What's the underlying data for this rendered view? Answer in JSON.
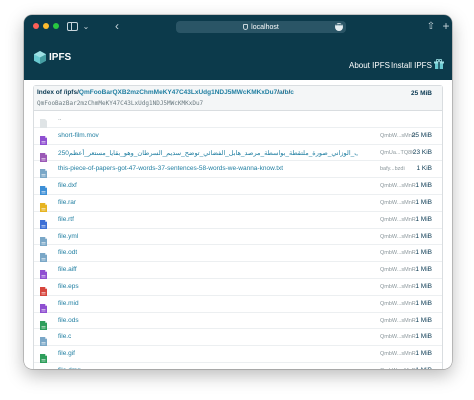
{
  "browser": {
    "address": "localhost",
    "address_more": "•••"
  },
  "header": {
    "logo_text": "IPFS",
    "nav_about": "About IPFS",
    "nav_install": "Install IPFS"
  },
  "index": {
    "prefix": "Index of /ipfs/",
    "cid_link": "QmFooBarQXB2mzChmMeKY47C43LxUdg1NDJ5MWcKMKxDu7",
    "path_a": "a",
    "path_b": "b",
    "path_c": "c",
    "slash": "/",
    "cid": "QmFooBazBar2mzChmMeKY47C43LxUdg1NDJ5MWcKMKxDu7",
    "size": "25 MiB"
  },
  "parent": {
    "name": ".."
  },
  "files": [
    {
      "name": "short-film.mov",
      "hash": "QmbW...sMnR",
      "size": "25 MiB",
      "icon": "video-icon",
      "color": "#8f4fd1"
    },
    {
      "name": "250ميغابايت_يوسف_الوزاني_صورة_ملتقطة_بواسطة_مرصد_هابل_الفضائي_توضح_سديم_السرطان_وهو_بقايا_مستعر_أعظم.jpg",
      "hash": "QmUa...TQ8K",
      "size": "23 KiB",
      "icon": "image-icon",
      "color": "#9b59b6"
    },
    {
      "name": "this-piece-of-papers-got-47-words-37-sentences-58-words-we-wanna-know.txt",
      "hash": "bafy...bzdi",
      "size": "1 KiB",
      "icon": "text-file-icon",
      "color": "#7aa7c7"
    },
    {
      "name": "file.dxf",
      "hash": "QmbW...sMnR",
      "size": "1 MiB",
      "icon": "dxf-file-icon",
      "color": "#3d8fd6"
    },
    {
      "name": "file.rar",
      "hash": "QmbW...sMnR",
      "size": "1 MiB",
      "icon": "archive-icon",
      "color": "#e6b422"
    },
    {
      "name": "file.rtf",
      "hash": "QmbW...sMnR",
      "size": "1 MiB",
      "icon": "rtf-file-icon",
      "color": "#3d6fd6"
    },
    {
      "name": "file.yml",
      "hash": "QmbW...sMnR",
      "size": "1 MiB",
      "icon": "yml-file-icon",
      "color": "#7aa7c7"
    },
    {
      "name": "file.odt",
      "hash": "QmbW...sMnR",
      "size": "1 MiB",
      "icon": "odt-file-icon",
      "color": "#7aa7c7"
    },
    {
      "name": "file.aiff",
      "hash": "QmbW...sMnR",
      "size": "1 MiB",
      "icon": "audio-icon",
      "color": "#8f4fd1"
    },
    {
      "name": "file.eps",
      "hash": "QmbW...sMnR",
      "size": "1 MiB",
      "icon": "eps-file-icon",
      "color": "#d6453d"
    },
    {
      "name": "file.mid",
      "hash": "QmbW...sMnR",
      "size": "1 MiB",
      "icon": "midi-file-icon",
      "color": "#8f4fd1"
    },
    {
      "name": "file.ods",
      "hash": "QmbW...sMnR",
      "size": "1 MiB",
      "icon": "spreadsheet-icon",
      "color": "#2e9e5b"
    },
    {
      "name": "file.c",
      "hash": "QmbW...sMnR",
      "size": "1 MiB",
      "icon": "code-file-icon",
      "color": "#7aa7c7"
    },
    {
      "name": "file.gif",
      "hash": "QmbW...sMnR",
      "size": "1 MiB",
      "icon": "gif-file-icon",
      "color": "#2e9e5b"
    },
    {
      "name": "file.dmg",
      "hash": "QmbW...sMnR",
      "size": "1 MiB",
      "icon": "disk-image-icon",
      "color": "#e6b422"
    }
  ]
}
